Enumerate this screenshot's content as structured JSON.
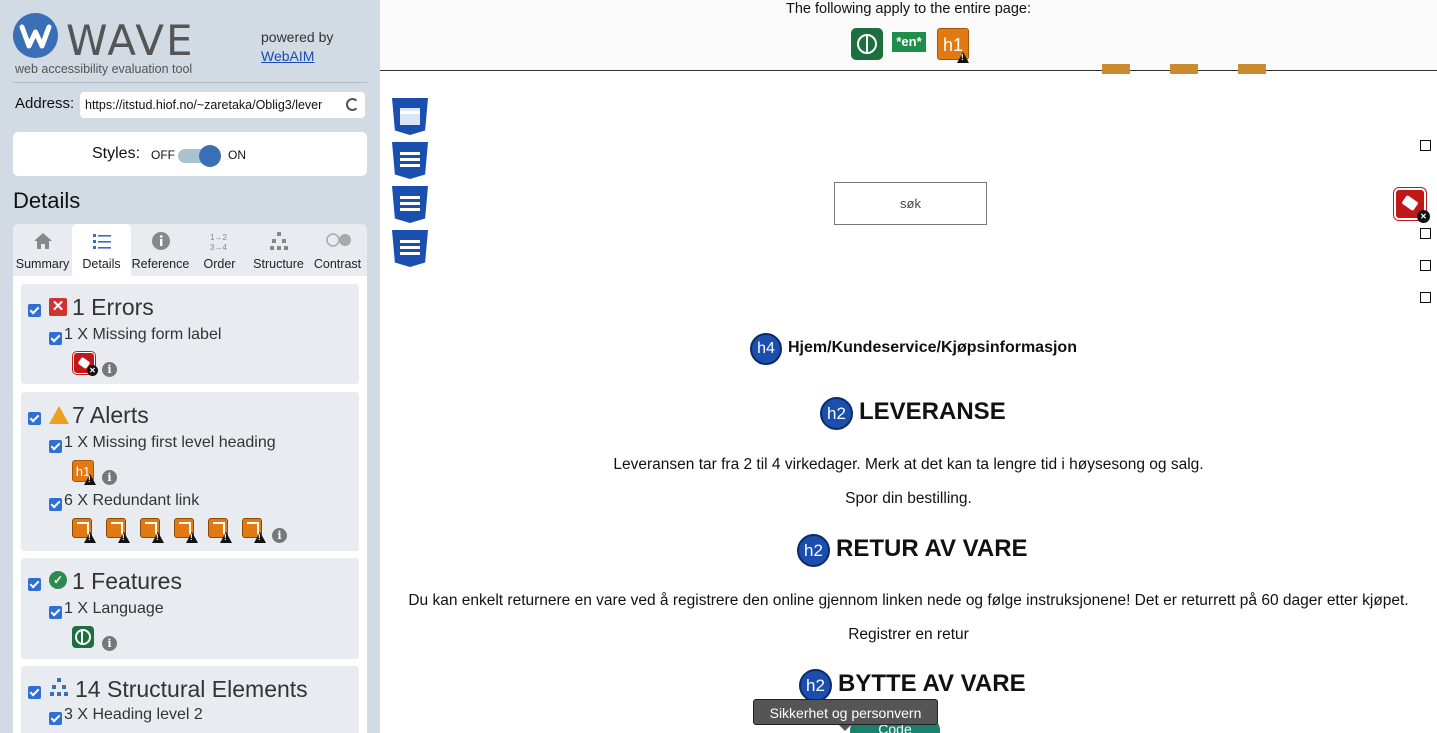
{
  "sidebar": {
    "logo_text": "WAVE",
    "logo_subtitle": "web accessibility evaluation tool",
    "powered_by": "powered by",
    "powered_link": "WebAIM",
    "address_label": "Address:",
    "address_value": "https://itstud.hiof.no/~zaretaka/Oblig3/lever",
    "styles_label": "Styles:",
    "styles_off": "OFF",
    "styles_on": "ON",
    "details_heading": "Details",
    "tabs": [
      {
        "label": "Summary",
        "icon": "home-icon"
      },
      {
        "label": "Details",
        "icon": "list-icon",
        "active": true
      },
      {
        "label": "Reference",
        "icon": "info-icon"
      },
      {
        "label": "Order",
        "icon": "order-icon"
      },
      {
        "label": "Structure",
        "icon": "structure-icon"
      },
      {
        "label": "Contrast",
        "icon": "contrast-icon"
      }
    ],
    "groups": {
      "errors": {
        "title": "1 Errors",
        "items": [
          "1 X Missing form label"
        ]
      },
      "alerts": {
        "title": "7 Alerts",
        "items": [
          "1 X Missing first level heading",
          "6 X Redundant link"
        ]
      },
      "features": {
        "title": "1 Features",
        "items": [
          "1 X Language"
        ]
      },
      "structural": {
        "title": "14 Structural Elements",
        "items": [
          "3 X Heading level 2"
        ]
      }
    }
  },
  "page": {
    "topbar_text": "The following apply to the entire page:",
    "lang_badge": "*en*",
    "h1_badge": "h1",
    "search_button": "søk",
    "h4_badge": "h4",
    "h2_badge": "h2",
    "breadcrumb": "Hjem/Kundeservice/Kjøpsinformasjon",
    "h2_1": "LEVERANSE",
    "p1": "Leveransen tar fra 2 til 4 virkedager. Merk at det kan ta lengre tid i høysesong og salg.",
    "p2": "Spor din bestilling.",
    "h2_2": "RETUR AV VARE",
    "p3": "Du kan enkelt returnere en vare ved å registrere den online gjennom linken nede og følge instruksjonene! Det er returrett på 60 dager etter kjøpet.",
    "p4": "Registrer en retur",
    "h2_3": "BYTTE AV VARE",
    "tooltip": "Sikkerhet og personvern",
    "code_button": "Code"
  },
  "colors": {
    "sidebar_bg": "#d2dae3",
    "wave_blue": "#3a6fb6",
    "error_red": "#d33030",
    "alert_orange": "#e17a12",
    "feature_green": "#1d6f3f"
  }
}
